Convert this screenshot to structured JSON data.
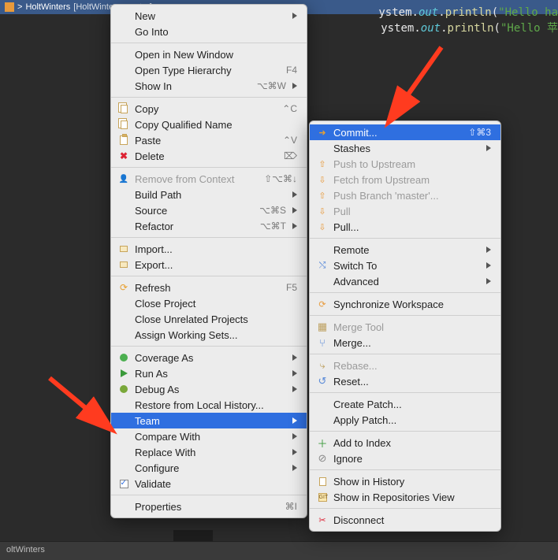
{
  "breadcrumb": {
    "project": "HoltWinters",
    "branch_tag": "[HoltWinters master]"
  },
  "code": {
    "line1_pre": "ystem.",
    "line1_out": "out",
    "line1_mid": ".",
    "line1_fn": "println",
    "line1_post": "(",
    "line1_str": "\"Hello ha",
    "line2_pre": "ystem.",
    "line2_out": "out",
    "line2_mid": ".",
    "line2_fn": "println",
    "line2_post": "(",
    "line2_str": "\"Hello 苹"
  },
  "statusbar": {
    "text": "oltWinters"
  },
  "menu1": {
    "new": "New",
    "go_into": "Go Into",
    "open_new_window": "Open in New Window",
    "open_type_hierarchy": "Open Type Hierarchy",
    "open_type_hierarchy_sc": "F4",
    "show_in": "Show In",
    "show_in_sc": "⌥⌘W",
    "copy": "Copy",
    "copy_sc": "⌃C",
    "copy_qualified": "Copy Qualified Name",
    "paste": "Paste",
    "paste_sc": "⌃V",
    "delete": "Delete",
    "delete_sc": "⌦",
    "remove_context": "Remove from Context",
    "remove_context_sc": "⇧⌥⌘↓",
    "build_path": "Build Path",
    "source": "Source",
    "source_sc": "⌥⌘S",
    "refactor": "Refactor",
    "refactor_sc": "⌥⌘T",
    "import": "Import...",
    "export": "Export...",
    "refresh": "Refresh",
    "refresh_sc": "F5",
    "close_project": "Close Project",
    "close_unrelated": "Close Unrelated Projects",
    "assign_ws": "Assign Working Sets...",
    "coverage_as": "Coverage As",
    "run_as": "Run As",
    "debug_as": "Debug As",
    "restore_history": "Restore from Local History...",
    "team": "Team",
    "compare_with": "Compare With",
    "replace_with": "Replace With",
    "configure": "Configure",
    "validate": "Validate",
    "properties": "Properties",
    "properties_sc": "⌘I"
  },
  "menu2": {
    "commit": "Commit...",
    "commit_sc": "⇧⌘3",
    "stashes": "Stashes",
    "push_upstream": "Push to Upstream",
    "fetch_upstream": "Fetch from Upstream",
    "push_branch": "Push Branch 'master'...",
    "pull": "Pull",
    "pull_dots": "Pull...",
    "remote": "Remote",
    "switch_to": "Switch To",
    "advanced": "Advanced",
    "sync_ws": "Synchronize Workspace",
    "merge_tool": "Merge Tool",
    "merge": "Merge...",
    "rebase": "Rebase...",
    "reset": "Reset...",
    "create_patch": "Create Patch...",
    "apply_patch": "Apply Patch...",
    "add_index": "Add to Index",
    "ignore": "Ignore",
    "show_history": "Show in History",
    "show_repos": "Show in Repositories View",
    "disconnect": "Disconnect"
  }
}
